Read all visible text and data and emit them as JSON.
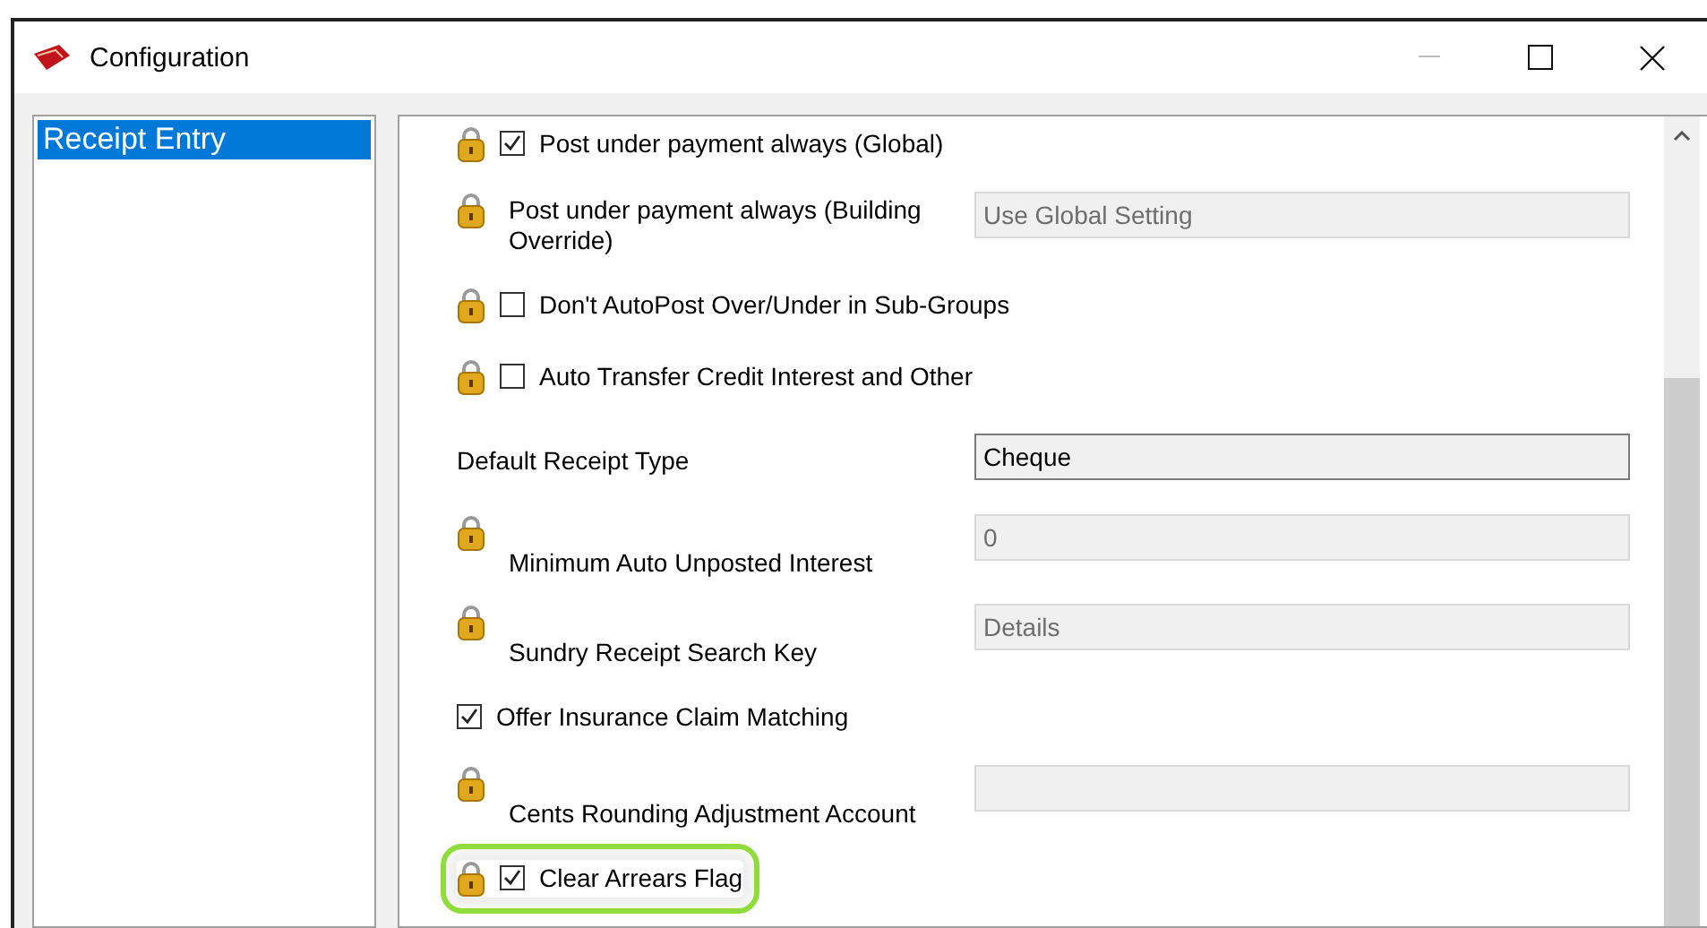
{
  "window": {
    "title": "Configuration"
  },
  "sidebar": {
    "items": [
      {
        "label": "Receipt Entry",
        "selected": true
      }
    ]
  },
  "settings": [
    {
      "kind": "checkbox",
      "locked": true,
      "checked": true,
      "highlighted": false,
      "label": "Post under payment always (Global)"
    },
    {
      "kind": "field",
      "locked": true,
      "disabled": true,
      "label": "Post under payment always (Building Override)",
      "value": "Use Global Setting"
    },
    {
      "kind": "checkbox",
      "locked": true,
      "checked": false,
      "highlighted": false,
      "label": "Don't AutoPost Over/Under in Sub-Groups"
    },
    {
      "kind": "checkbox",
      "locked": true,
      "checked": false,
      "highlighted": false,
      "label": "Auto Transfer Credit Interest and Other"
    },
    {
      "kind": "field",
      "locked": false,
      "disabled": false,
      "label": "Default Receipt Type",
      "value": "Cheque"
    },
    {
      "kind": "field",
      "locked": true,
      "disabled": true,
      "label": "Minimum Auto Unposted Interest",
      "value": "0"
    },
    {
      "kind": "field",
      "locked": true,
      "disabled": true,
      "label": "Sundry Receipt Search Key",
      "value": "Details"
    },
    {
      "kind": "checkbox",
      "locked": false,
      "checked": true,
      "highlighted": false,
      "label": "Offer Insurance Claim Matching"
    },
    {
      "kind": "field",
      "locked": true,
      "disabled": true,
      "label": "Cents Rounding Adjustment Account"
    },
    {
      "kind": "checkbox",
      "locked": true,
      "checked": true,
      "highlighted": true,
      "label": "Clear Arrears Flag"
    }
  ]
}
